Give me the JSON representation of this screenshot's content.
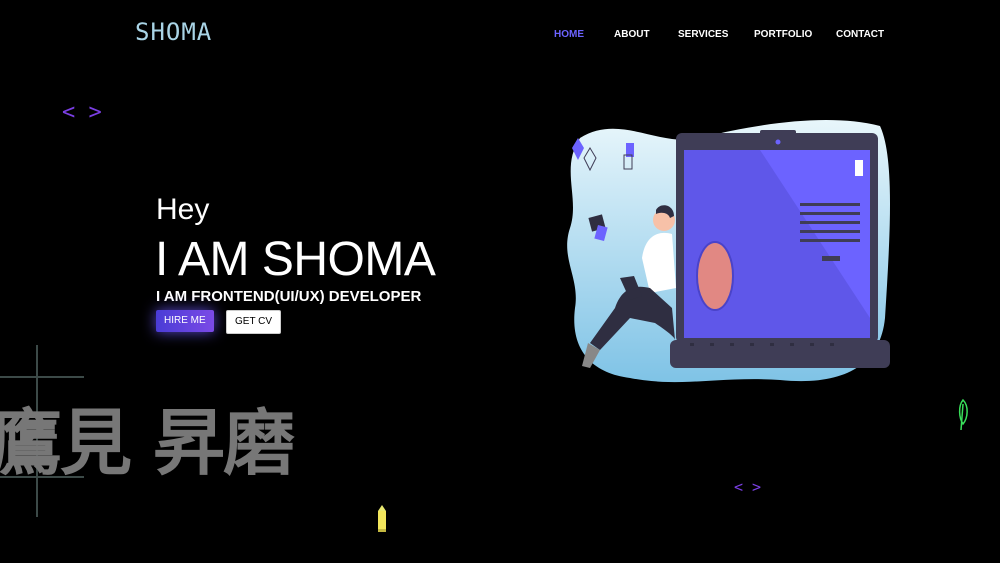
{
  "logo": {
    "text": "SHOMA"
  },
  "nav": {
    "items": [
      {
        "label": "HOME",
        "active": true
      },
      {
        "label": "ABOUT"
      },
      {
        "label": "SERVICES"
      },
      {
        "label": "PORTFOLIO"
      },
      {
        "label": "CONTACT"
      }
    ]
  },
  "hero": {
    "greeting": "Hey",
    "name": "I AM SHOMA",
    "role": "I AM FRONTEND(UI/UX) DEVELOPER",
    "hire_label": "HIRE ME",
    "cv_label": "GET CV"
  },
  "decor": {
    "code_tag": "< >",
    "japanese_text": "鷹見 昇磨"
  },
  "colors": {
    "accent": "#6c63ff",
    "code_tag": "#7b3fe4",
    "background": "#000000"
  },
  "icons": [
    "code-brackets-icon",
    "feather-icon",
    "pencil-icon"
  ]
}
